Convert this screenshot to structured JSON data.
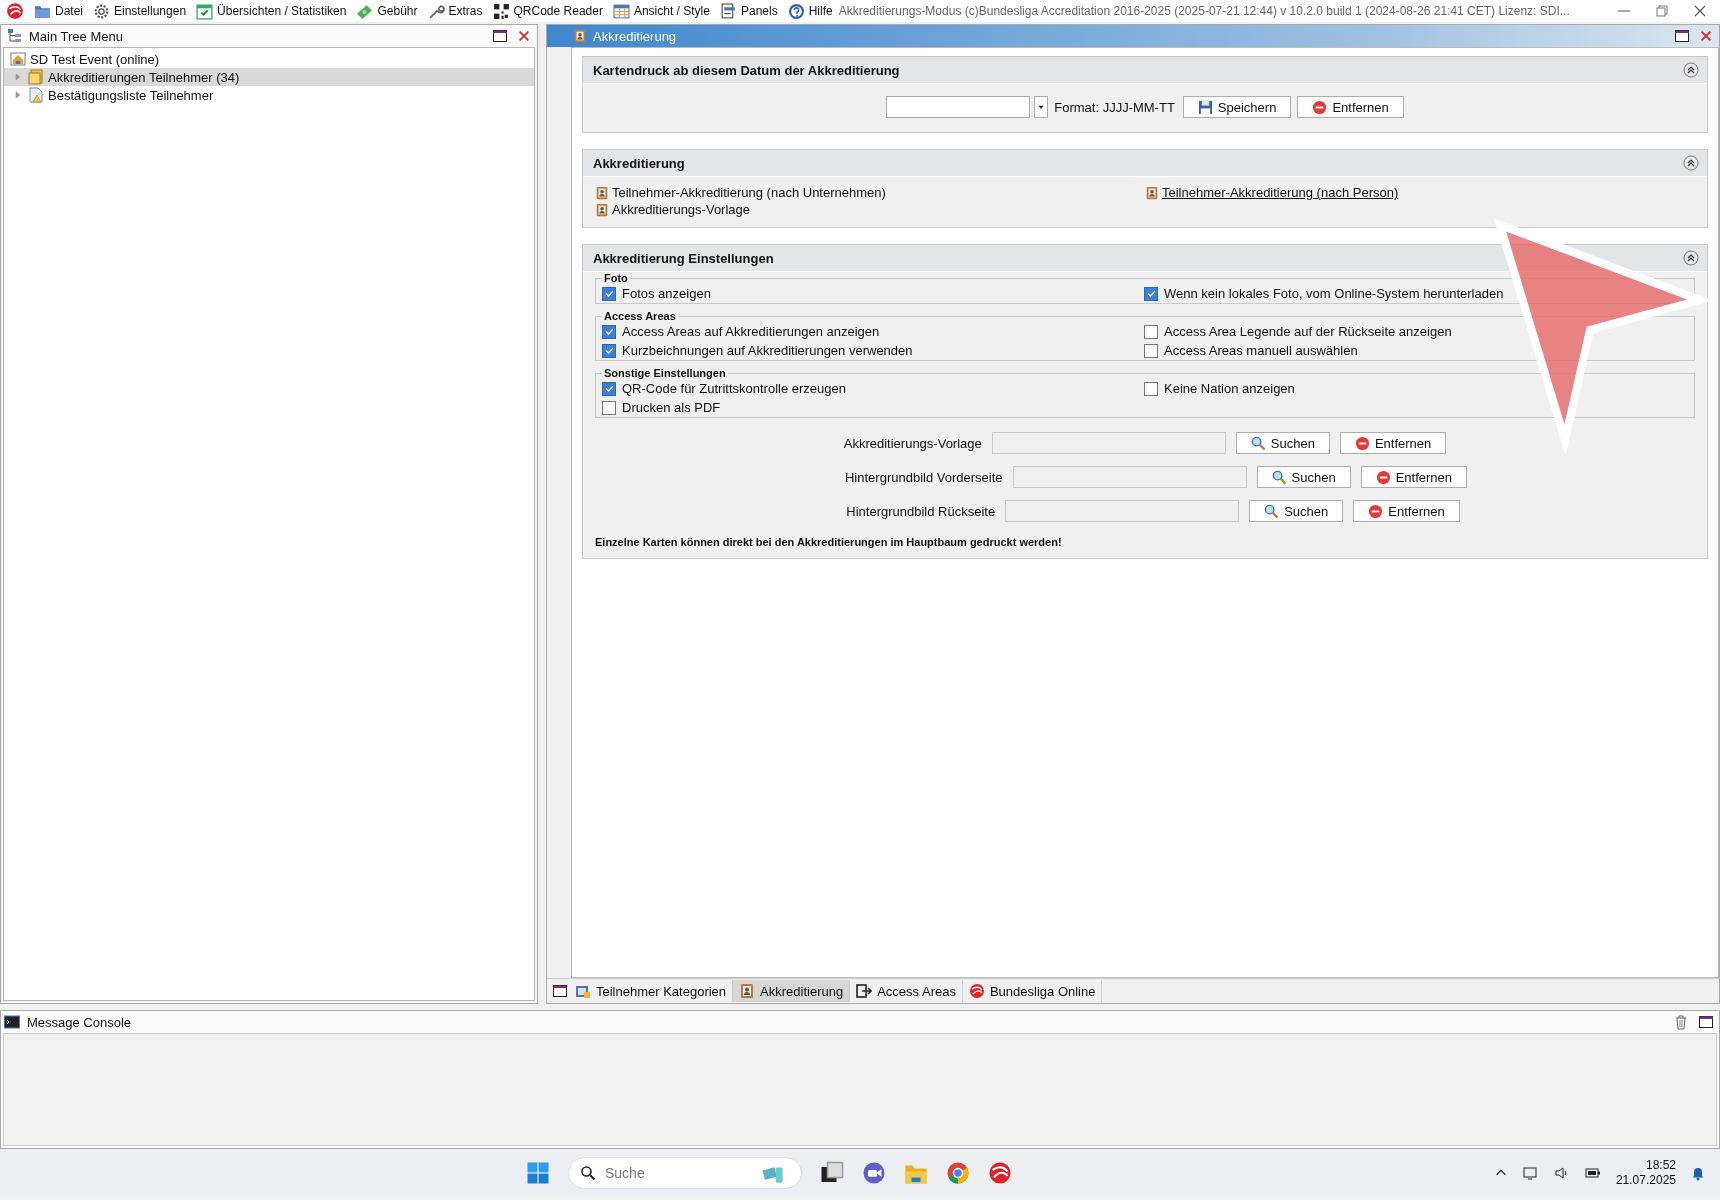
{
  "menu_bar": {
    "items": [
      {
        "label": "Datei",
        "kind": "folder"
      },
      {
        "label": "Einstellungen",
        "kind": "gear"
      },
      {
        "label": "Übersichten / Statistiken",
        "kind": "calendar"
      },
      {
        "label": "Gebühr",
        "kind": "money"
      },
      {
        "label": "Extras",
        "kind": "wrench"
      },
      {
        "label": "QRCode Reader",
        "kind": "qr"
      },
      {
        "label": "Ansicht / Style",
        "kind": "grid"
      },
      {
        "label": "Panels",
        "kind": "panels"
      },
      {
        "label": "Hilfe",
        "kind": "help"
      }
    ],
    "title": "Akkreditierungs-Modus (c)Bundesliga Accreditation 2016-2025 (2025-07-21 12:44) v 10.2.0 build 1 (2024-08-26 21:41 CET) Lizenz: SDI..."
  },
  "tree_panel": {
    "title": "Main Tree Menu",
    "items": [
      {
        "label": "SD Test Event (online)",
        "selected": false,
        "children": [
          {
            "label": "Akkreditierungen Teilnehmer (34)",
            "selected": true,
            "expanded": false
          },
          {
            "label": "Bestätigungsliste Teilnehmer",
            "selected": false,
            "expanded": false
          }
        ]
      }
    ]
  },
  "document_panel": {
    "title": "Akkreditierung",
    "date_section": {
      "title": "Kartendruck ab diesem Datum der Akkreditierung",
      "format": "Format: JJJJ-MM-TT",
      "buttons": [
        {
          "label": "Speichern",
          "kind": "save"
        },
        {
          "label": "Entfernen",
          "kind": "remove"
        }
      ]
    },
    "links_section": {
      "title": "Akkreditierung",
      "columns": [
        [
          {
            "label": "Teilnehmer-Akkreditierung (nach Unternehmen)",
            "hover": false
          },
          {
            "label": "Akkreditierungs-Vorlage",
            "hover": false
          }
        ],
        [
          {
            "label": "Teilnehmer-Akkreditierung (nach Person)",
            "hover": true
          }
        ]
      ]
    },
    "settings_section": {
      "title": "Akkreditierung Einstellungen",
      "groups": [
        {
          "title": "Foto",
          "options": [
            {
              "label": "Fotos anzeigen",
              "checked": true
            },
            {
              "label": "Wenn kein lokales Foto, vom Online-System herunterladen",
              "checked": true
            }
          ]
        },
        {
          "title": "Access Areas",
          "options": [
            {
              "label": "Access Areas auf Akkreditierungen anzeigen",
              "checked": true
            },
            {
              "label": "Access Area Legende auf der Rückseite anzeigen",
              "checked": false
            },
            {
              "label": "Kurzbeichnungen auf Akkreditierungen verwenden",
              "checked": true
            },
            {
              "label": "Access Areas manuell auswählen",
              "checked": false
            }
          ]
        },
        {
          "title": "Sonstige Einstellungen",
          "options": [
            {
              "label": "QR-Code für Zutrittskontrolle erzeugen",
              "checked": true
            },
            {
              "label": "Keine Nation anzeigen",
              "checked": false
            },
            {
              "label": "Drucken als PDF",
              "checked": false
            }
          ]
        }
      ],
      "file_rows": [
        {
          "label": "Akkreditierungs-Vorlage",
          "buttons": [
            {
              "label": "Suchen",
              "kind": "search"
            },
            {
              "label": "Entfernen",
              "kind": "remove"
            }
          ]
        },
        {
          "label": "Hintergrundbild Vorderseite",
          "buttons": [
            {
              "label": "Suchen",
              "kind": "search"
            },
            {
              "label": "Entfernen",
              "kind": "remove"
            }
          ]
        },
        {
          "label": "Hintergrundbild Rückseite",
          "buttons": [
            {
              "label": "Suchen",
              "kind": "search"
            },
            {
              "label": "Entfernen",
              "kind": "remove"
            }
          ]
        }
      ],
      "note": "Einzelne Karten können direkt bei den Akkreditierungen im Hauptbaum gedruckt werden!"
    },
    "tabs": [
      {
        "label": "Teilnehmer Kategorien",
        "selected": false,
        "kind": "category"
      },
      {
        "label": "Akkreditierung",
        "selected": true,
        "kind": "badge"
      },
      {
        "label": "Access Areas",
        "selected": false,
        "kind": "enter"
      },
      {
        "label": "Bundesliga Online",
        "selected": false,
        "kind": "logo"
      }
    ]
  },
  "console": {
    "title": "Message Console"
  },
  "taskbar": {
    "search": {
      "placeholder": "Suche"
    },
    "time": "18:52",
    "date": "21.07.2025"
  }
}
